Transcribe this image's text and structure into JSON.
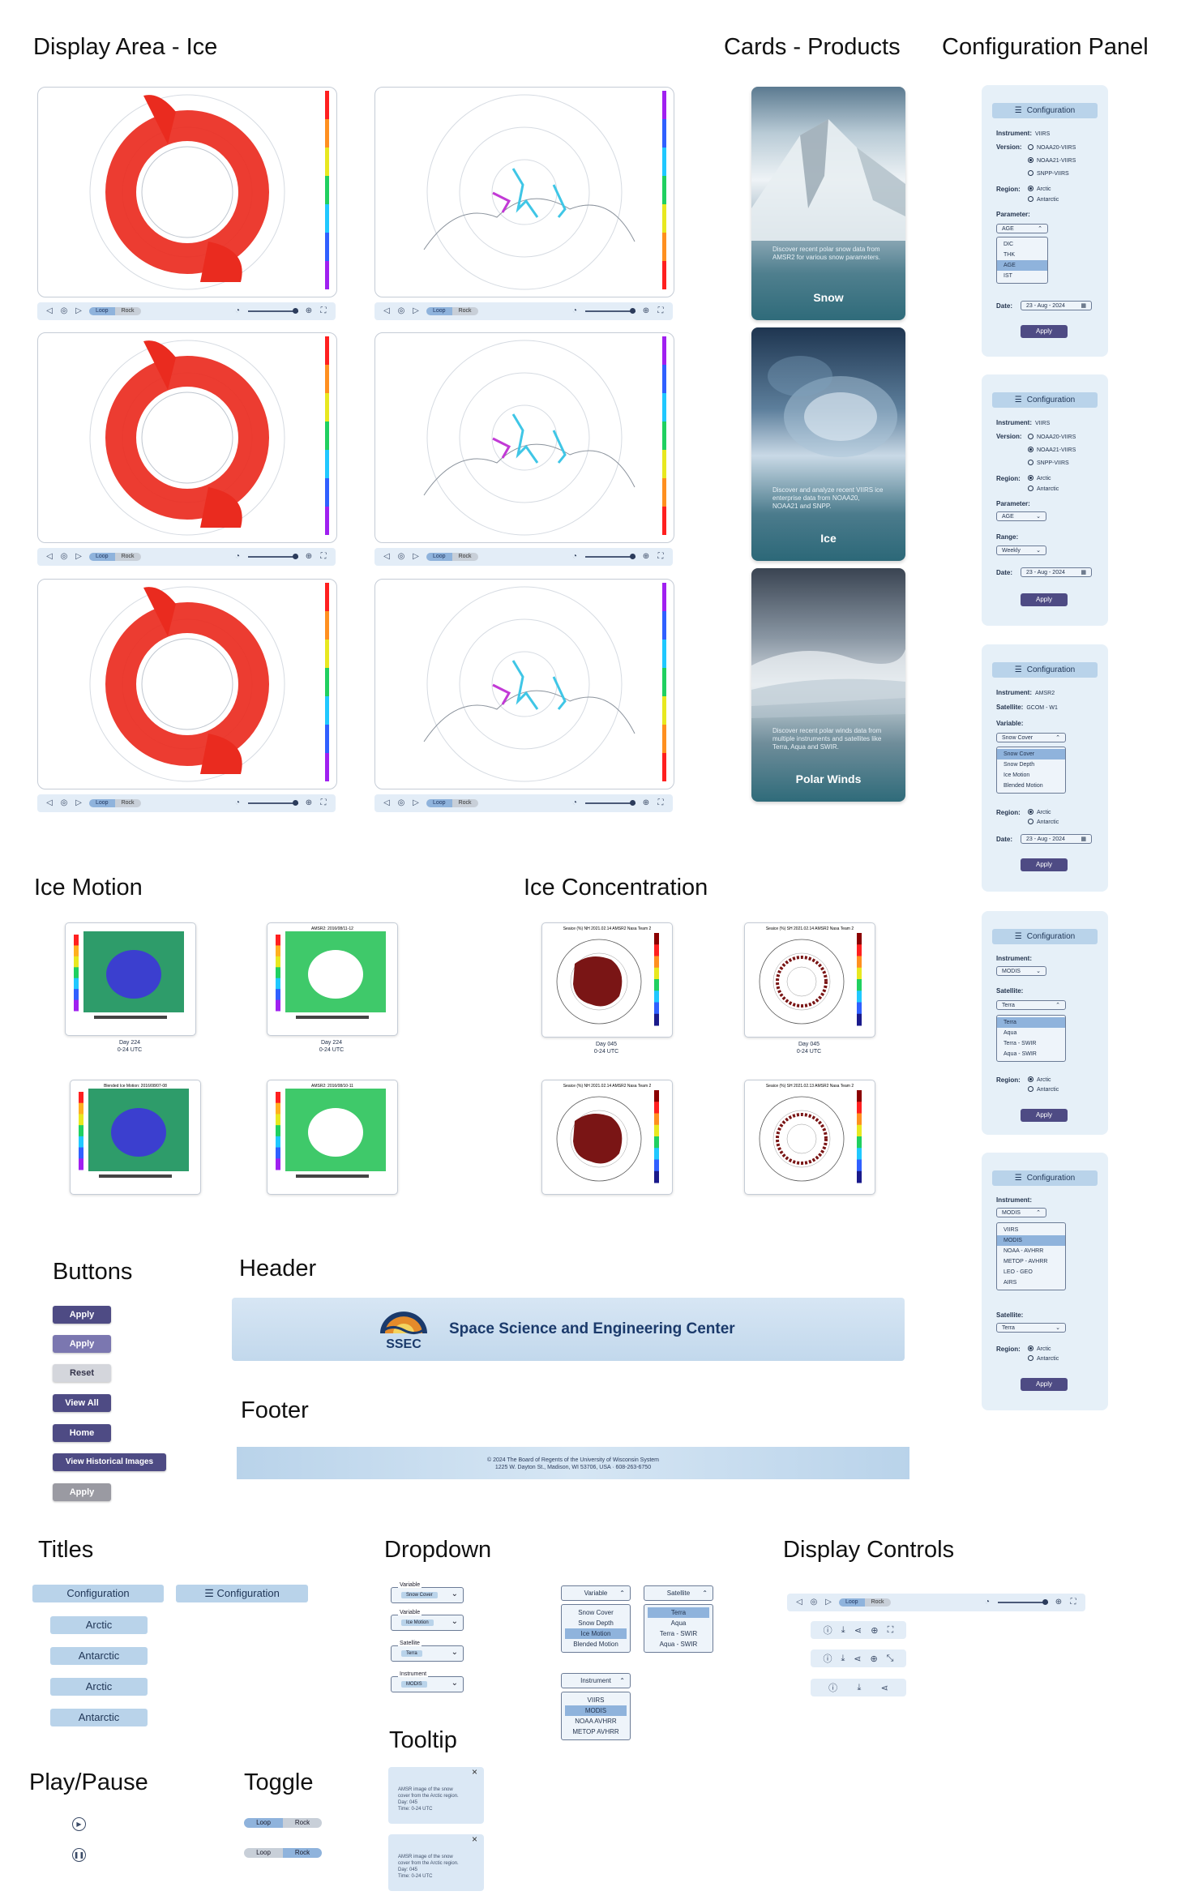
{
  "sections": {
    "display_area": "Display Area - Ice",
    "cards": "Cards - Products",
    "config": "Configuration Panel",
    "ice_motion": "Ice Motion",
    "ice_concentration": "Ice Concentration",
    "buttons": "Buttons",
    "header": "Header",
    "footer": "Footer",
    "titles": "Titles",
    "dropdown": "Dropdown",
    "display_controls": "Display Controls",
    "tooltip": "Tooltip",
    "play_pause": "Play/Pause",
    "toggle": "Toggle"
  },
  "ctrl": {
    "loop": "Loop",
    "rock": "Rock"
  },
  "cards": [
    {
      "desc": "Discover recent polar snow data from AMSR2 for various snow parameters.",
      "title": "Snow"
    },
    {
      "desc": "Discover and analyze recent VIIRS ice enterprise data from NOAA20, NOAA21 and SNPP.",
      "title": "Ice"
    },
    {
      "desc": "Discover recent polar winds data from multiple instruments and satellites like Terra, Aqua and SWIR.",
      "title": "Polar Winds"
    }
  ],
  "cfg": {
    "title": "Configuration",
    "instrument": "Instrument:",
    "version": "Version:",
    "region": "Region:",
    "parameter": "Parameter:",
    "range": "Range:",
    "date": "Date:",
    "satellite": "Satellite:",
    "variable": "Variable:",
    "apply": "Apply",
    "viirs": "VIIRS",
    "amsr2": "AMSR2",
    "modis": "MODIS",
    "gcom": "GCOM - W1",
    "noaa20": "NOAA20-VIIRS",
    "noaa21": "NOAA21-VIIRS",
    "snpp": "SNPP-VIIRS",
    "arctic": "Arctic",
    "antarctic": "Antarctic",
    "age": "AGE",
    "weekly": "Weekly",
    "date_val": "23 - Aug - 2024",
    "params": [
      "DIC",
      "THK",
      "AGE",
      "IST"
    ],
    "snow_cover": "Snow Cover",
    "vars": [
      "Snow Cover",
      "Snow Depth",
      "Ice Motion",
      "Blended Motion"
    ],
    "terra": "Terra",
    "sats": [
      "Terra",
      "Aqua",
      "Terra - SWIR",
      "Aqua - SWIR"
    ],
    "insts": [
      "VIIRS",
      "MODIS",
      "NOAA - AVHRR",
      "METOP - AVHRR",
      "LEO - GEO",
      "AIRS"
    ]
  },
  "motion": [
    {
      "title": "",
      "cap1": "Day 224",
      "cap2": "0-24 UTC"
    },
    {
      "title": "AMSR2: 2016/08/11-12",
      "cap1": "Day 224",
      "cap2": "0-24 UTC"
    },
    {
      "title": "Blended Ice Motion: 2016/08/07-08",
      "cap1": "",
      "cap2": ""
    },
    {
      "title": "AMSR2: 2016/08/10-11",
      "cap1": "",
      "cap2": ""
    }
  ],
  "conc": [
    {
      "title": "Seaice (%) NH 2021.02.14 AMSR2 Nasa Team 2",
      "cap1": "Day 045",
      "cap2": "0-24 UTC"
    },
    {
      "title": "Seaice (%) SH 2021.02.14 AMSR2 Nasa Team 2",
      "cap1": "Day 045",
      "cap2": "0-24 UTC"
    },
    {
      "title": "Seaice (%) NH 2021.02.14 AMSR2 Nasa Team 2",
      "cap1": "",
      "cap2": ""
    },
    {
      "title": "Seaice (%) SH 2021.02.13 AMSR2 Nasa Team 2",
      "cap1": "",
      "cap2": ""
    }
  ],
  "buttons": [
    "Apply",
    "Apply",
    "Reset",
    "View All",
    "Home",
    "View Historical Images",
    "Apply"
  ],
  "header": {
    "logo": "SSEC",
    "name": "Space Science and Engineering Center"
  },
  "footer": {
    "line1": "© 2024 The Board of Regents of the University of Wisconsin System",
    "line2": "1225 W. Dayton St., Madison, WI 53706, USA · 608-263-6750"
  },
  "titles": {
    "configuration": "Configuration",
    "arctic": "Arctic",
    "antarctic": "Antarctic"
  },
  "dropdown": {
    "variable": "Variable",
    "satellite": "Satellite",
    "instrument": "Instrument",
    "snow_cover": "Snow Cover",
    "ice_motion": "Ice Motion",
    "terra": "Terra",
    "modis": "MODIS",
    "var_opts": [
      "Snow Cover",
      "Snow Depth",
      "Ice Motion",
      "Blended Motion"
    ],
    "sat_opts": [
      "Terra",
      "Aqua",
      "Terra - SWIR",
      "Aqua - SWIR"
    ],
    "inst_opts": [
      "VIIRS",
      "MODIS",
      "NOAA AVHRR",
      "METOP AVHRR"
    ]
  },
  "tooltip": {
    "l1": "AMSR image of the snow",
    "l2": "cover from the Arctic region.",
    "l3": "Day: 045",
    "l4": "Time: 0-24 UTC"
  },
  "colors": {
    "apply": "#4e4b84",
    "apply_light": "#7b77b0",
    "reset": "#d4d6dc",
    "disabled": "#9a9aa2",
    "pill": "#b9d3ea",
    "panel": "#e6f0f8",
    "ice_red": "#ea2b1f",
    "conc_brown": "#7a1515"
  }
}
